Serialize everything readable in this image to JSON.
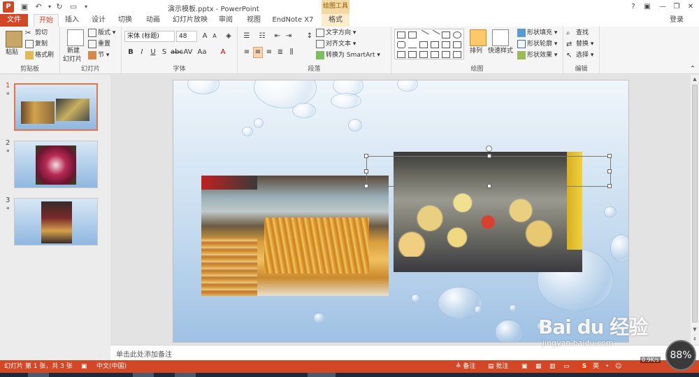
{
  "app": {
    "title": "演示模板.pptx - PowerPoint",
    "context_tab_group": "绘图工具",
    "login": "登录",
    "help": "?",
    "colors": {
      "accent": "#d24726",
      "context": "#f3d9a4"
    }
  },
  "tabs": [
    {
      "label": "文件"
    },
    {
      "label": "开始"
    },
    {
      "label": "插入"
    },
    {
      "label": "设计"
    },
    {
      "label": "切换"
    },
    {
      "label": "动画"
    },
    {
      "label": "幻灯片放映"
    },
    {
      "label": "审阅"
    },
    {
      "label": "视图"
    },
    {
      "label": "EndNote X7"
    },
    {
      "label": "格式"
    }
  ],
  "ribbon": {
    "clipboard": {
      "label": "剪贴板",
      "paste": "粘贴",
      "cut": "剪切",
      "copy": "复制",
      "format_painter": "格式刷"
    },
    "slides": {
      "label": "幻灯片",
      "new_slide_1": "新建",
      "new_slide_2": "幻灯片",
      "layout": "版式",
      "reset": "重置",
      "section": "节"
    },
    "font": {
      "label": "字体",
      "font_name": "宋体 (标题)",
      "font_size": "48"
    },
    "paragraph": {
      "label": "段落",
      "text_direction": "文字方向",
      "align_text": "对齐文本",
      "smartart": "转换为 SmartArt"
    },
    "drawing": {
      "label": "绘图",
      "arrange": "排列",
      "quick_styles": "快速样式",
      "shape_fill": "形状填充",
      "shape_outline": "形状轮廓",
      "shape_effects": "形状效果"
    },
    "editing": {
      "label": "编辑",
      "find": "查找",
      "replace": "替换",
      "select": "选择"
    }
  },
  "thumbnails": [
    {
      "number": "1",
      "star": "*"
    },
    {
      "number": "2",
      "star": "*"
    },
    {
      "number": "3",
      "star": "*"
    }
  ],
  "notes": {
    "placeholder": "单击此处添加备注"
  },
  "status": {
    "slide_info": "幻灯片 第 1 张，共 3 张",
    "language": "中文(中国)",
    "notes": "备注",
    "comments": "批注",
    "ime": "英"
  },
  "watermark": {
    "logo": "Bai du 经验",
    "url": "jingyan.baidu.com"
  },
  "speed": {
    "value": "88%",
    "rate": "0.9K/s"
  }
}
